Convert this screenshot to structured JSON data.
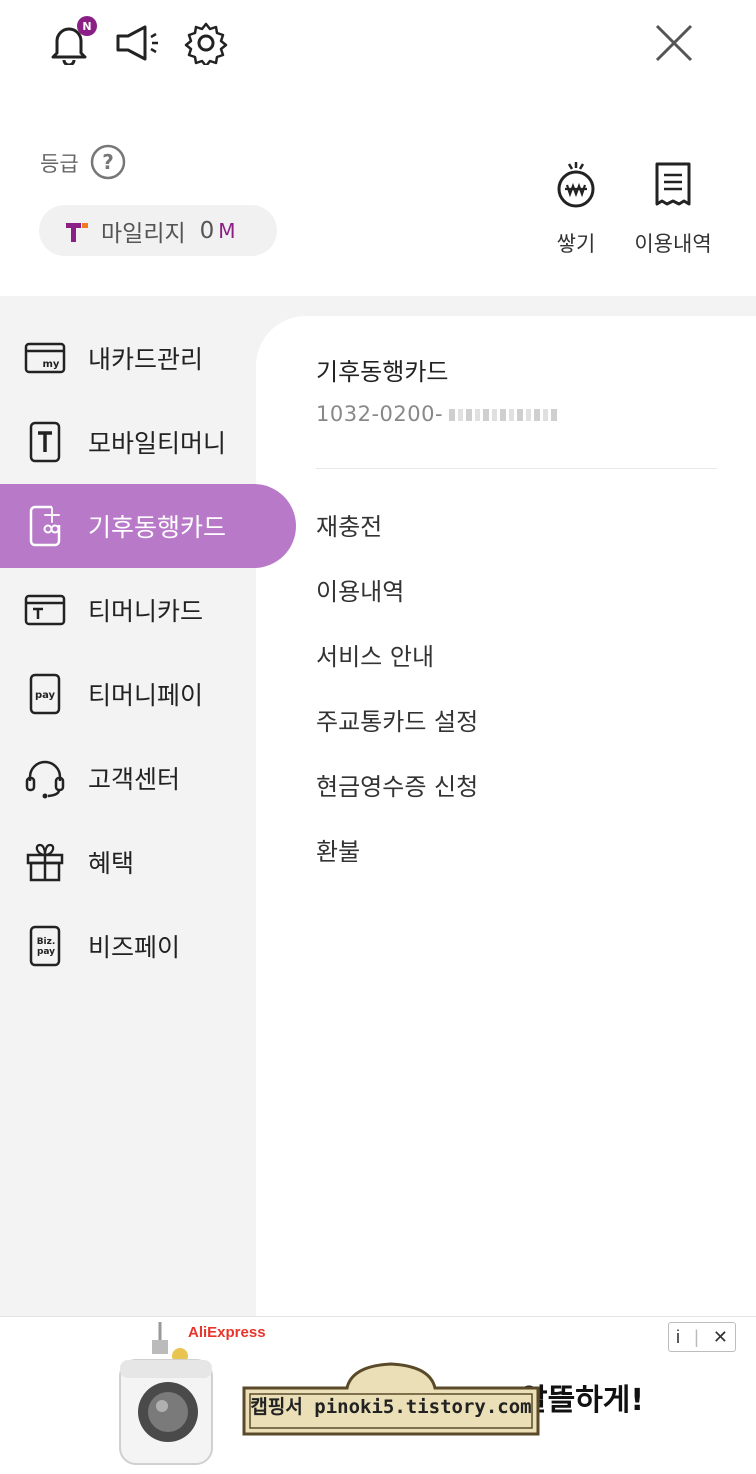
{
  "topbar": {
    "notification_badge": "N",
    "icons": [
      "bell-icon",
      "megaphone-icon",
      "gear-icon",
      "close-icon"
    ]
  },
  "grade": {
    "label": "등급"
  },
  "mileage": {
    "label": "마일리지",
    "value": "0",
    "unit": "M"
  },
  "quick_actions": [
    {
      "label": "쌓기",
      "icon": "coin-pouch-icon"
    },
    {
      "label": "이용내역",
      "icon": "receipt-icon"
    }
  ],
  "sidebar": {
    "items": [
      {
        "label": "내카드관리",
        "icon": "my-card-icon",
        "active": false
      },
      {
        "label": "모바일티머니",
        "icon": "mobile-tmoney-icon",
        "active": false
      },
      {
        "label": "기후동행카드",
        "icon": "climate-card-icon",
        "active": true
      },
      {
        "label": "티머니카드",
        "icon": "tmoney-card-icon",
        "active": false
      },
      {
        "label": "티머니페이",
        "icon": "tmoney-pay-icon",
        "active": false
      },
      {
        "label": "고객센터",
        "icon": "headset-icon",
        "active": false
      },
      {
        "label": "혜택",
        "icon": "gift-icon",
        "active": false
      },
      {
        "label": "비즈페이",
        "icon": "biz-pay-icon",
        "active": false
      }
    ]
  },
  "card_detail": {
    "title": "기후동행카드",
    "number_prefix": "1032-0200-"
  },
  "menu": {
    "items": [
      "재충전",
      "이용내역",
      "서비스 안내",
      "주교통카드 설정",
      "현금영수증 신청",
      "환불"
    ]
  },
  "ad": {
    "brand": "AliExpress",
    "headline_fragment": "알뜰하게!",
    "info_label": "i",
    "close_label": "✕",
    "watermark": "캡핑서 pinoki5.tistory.com"
  },
  "colors": {
    "accent": "#8a1f86",
    "active_item_bg": "#b87ac8",
    "sidebar_bg": "#f3f3f3"
  }
}
